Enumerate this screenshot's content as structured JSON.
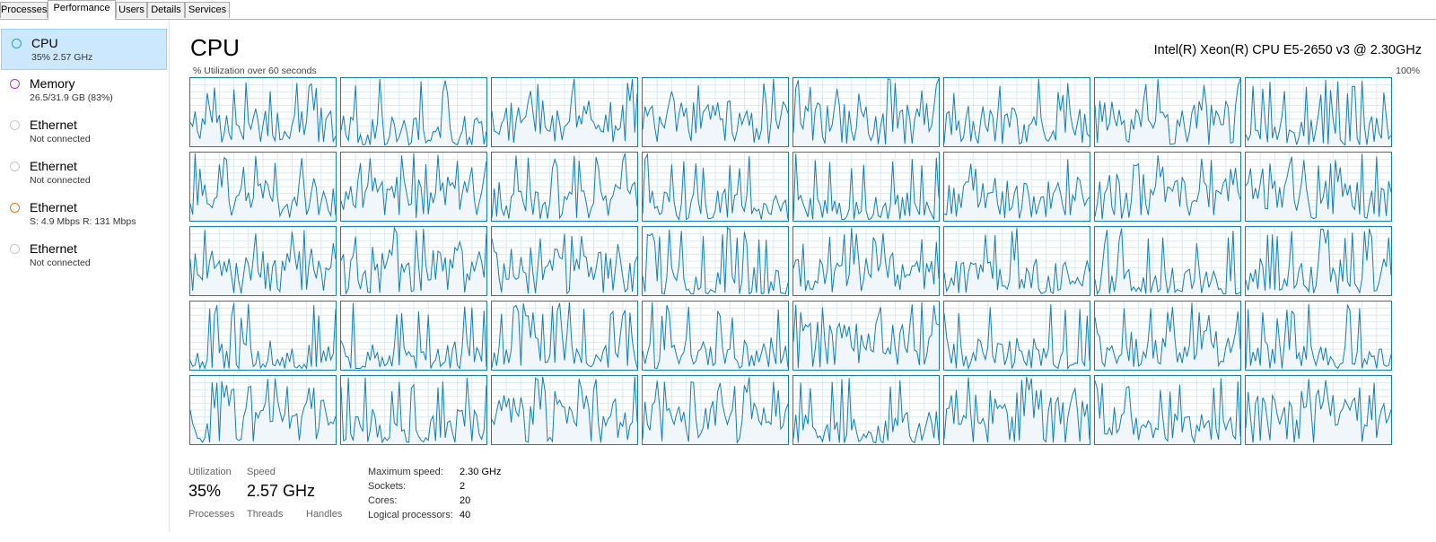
{
  "tabs": [
    "Processes",
    "Performance",
    "Users",
    "Details",
    "Services"
  ],
  "sidebar": {
    "items": [
      {
        "name": "CPU",
        "sub": "35%  2.57 GHz",
        "ring_color": "#17a1e0",
        "selected": true
      },
      {
        "name": "Memory",
        "sub": "26.5/31.9 GB (83%)",
        "ring_color": "#a335c8",
        "selected": false
      },
      {
        "name": "Ethernet",
        "sub": "Not connected",
        "ring_color": "#c8c8c8",
        "selected": false
      },
      {
        "name": "Ethernet",
        "sub": "Not connected",
        "ring_color": "#c8c8c8",
        "selected": false
      },
      {
        "name": "Ethernet",
        "sub": "S: 4.9 Mbps  R: 131 Mbps",
        "ring_color": "#d97a1e",
        "selected": false
      },
      {
        "name": "Ethernet",
        "sub": "Not connected",
        "ring_color": "#c8c8c8",
        "selected": false
      }
    ]
  },
  "main": {
    "title": "CPU",
    "cpu_model": "Intel(R) Xeon(R) CPU E5-2650 v3 @ 2.30GHz",
    "util_caption": "% Utilization over 60 seconds",
    "pct_caption": "100%",
    "graph_color": "#117dbb",
    "graph_fill": "#f1f6fa",
    "logical_graphs": 40
  },
  "stats": {
    "utilization_label": "Utilization",
    "utilization_value": "35%",
    "speed_label": "Speed",
    "speed_value": "2.57 GHz",
    "processes_label": "Processes",
    "threads_label": "Threads",
    "handles_label": "Handles"
  },
  "specs": {
    "max_speed_label": "Maximum speed:",
    "max_speed_value": "2.30 GHz",
    "sockets_label": "Sockets:",
    "sockets_value": "2",
    "cores_label": "Cores:",
    "cores_value": "20",
    "logical_label": "Logical processors:",
    "logical_value": "40"
  }
}
